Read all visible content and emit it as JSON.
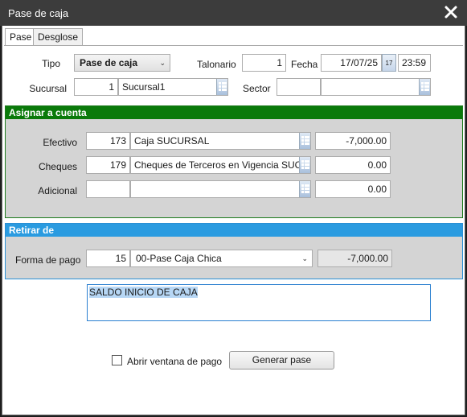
{
  "window": {
    "title": "Pase de caja"
  },
  "tabs": [
    {
      "label": "Pase"
    },
    {
      "label": "Desglose"
    }
  ],
  "header": {
    "tipo_label": "Tipo",
    "tipo_value": "Pase de caja",
    "talonario_label": "Talonario",
    "talonario_value": "1",
    "fecha_label": "Fecha",
    "fecha_value": "17/07/25",
    "calendar_day": "17",
    "hora_value": "23:59",
    "sucursal_label": "Sucursal",
    "sucursal_code": "1",
    "sucursal_name": "Sucursal1",
    "sector_label": "Sector",
    "sector_code": "",
    "sector_name": ""
  },
  "asignar": {
    "title": "Asignar a cuenta",
    "rows": [
      {
        "label": "Efectivo",
        "code": "173",
        "name": "Caja SUCURSAL",
        "amount": "-7,000.00"
      },
      {
        "label": "Cheques",
        "code": "179",
        "name": "Cheques de Terceros en Vigencia SUCU",
        "amount": "0.00"
      },
      {
        "label": "Adicional",
        "code": "",
        "name": "",
        "amount": "0.00"
      }
    ]
  },
  "retirar": {
    "title": "Retirar de",
    "forma_label": "Forma de pago",
    "forma_code": "15",
    "forma_value": "00-Pase Caja Chica",
    "amount": "-7,000.00"
  },
  "memo": {
    "text": "SALDO INICIO DE CAJA"
  },
  "footer": {
    "checkbox_label": "Abrir ventana de pago",
    "button_label": "Generar pase"
  }
}
